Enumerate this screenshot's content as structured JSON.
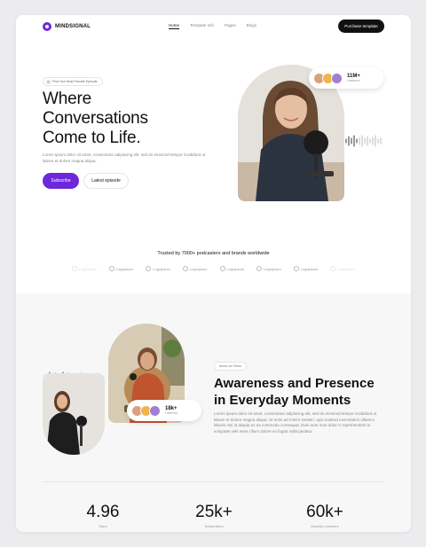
{
  "nav": {
    "brand": "MINDSIGNAL",
    "links": [
      "Home",
      "Template Info",
      "Pages",
      "Blogs"
    ],
    "cta": "Purchase template"
  },
  "hero": {
    "chip": "Find Your Most Favorite Episode",
    "title_lines": [
      "Where",
      "Conversations",
      "Come to Life."
    ],
    "description": "Lorem ipsum dolor sit amet, consectetur adipiscing elit, sed do eiusmod tempor incididunt ut labore et dolore magna aliqua.",
    "primary_button": "Subscribe",
    "secondary_button": "Latest episode",
    "listeners": {
      "count": "11M+",
      "label": "Listeners"
    }
  },
  "trusted": {
    "heading": "Trusted by 7000+ podcasters and brands worldwide",
    "logos": [
      "Logoipsum",
      "Logoipsum",
      "Logoipsum",
      "Logoipsum",
      "Logoipsum",
      "Logoipsum",
      "Logoipsum",
      "Logoipsum"
    ]
  },
  "about": {
    "chip": "About our Show",
    "title_lines": [
      "Awareness and Presence",
      "in Everyday Moments"
    ],
    "description": "Lorem ipsum dolor sit amet, consectetur adipiscing elit, sed do eiusmod tempor incididunt ut labore et dolore magna aliqua. Ut enim ad minim veniam, quis nostrud exercitation ullamco laboris nisi ut aliquip ex ea commodo consequat. Duis aute irure dolor in reprehenderit in voluptate velit esse cillum dolore eu fugiat nulla pariatur.",
    "listeners": {
      "count": "18k+",
      "label": "Listeners"
    },
    "stats": [
      {
        "value": "4.96",
        "label": "Stars"
      },
      {
        "value": "25k+",
        "label": "Subscribers"
      },
      {
        "value": "60k+",
        "label": "Monthly Listeners"
      }
    ]
  },
  "colors": {
    "accent": "#6d28d9",
    "dark": "#111111",
    "muted": "#888888",
    "section_bg": "#f7f7f8"
  },
  "icons": [
    "logo-mark-icon",
    "headphone-icon",
    "brand-logo-icon",
    "soundwave-icon"
  ]
}
